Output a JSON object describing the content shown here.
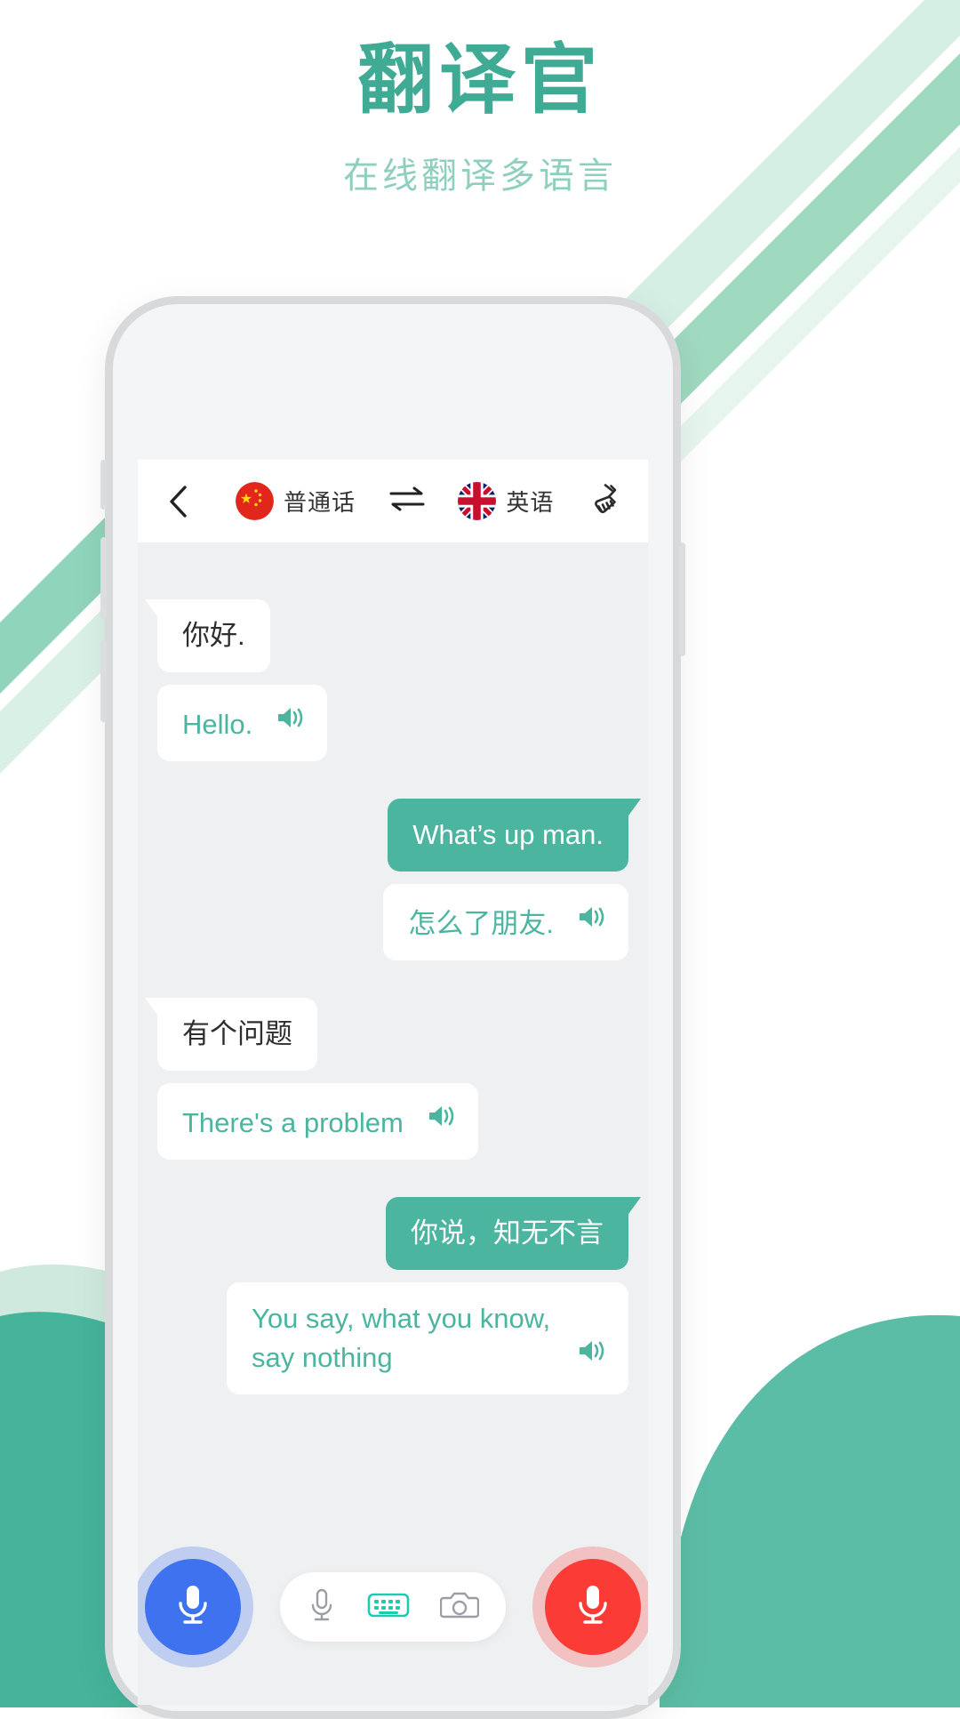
{
  "header": {
    "title": "翻译官",
    "subtitle": "在线翻译多语言"
  },
  "colors": {
    "brand_green": "#3fab95",
    "subtitle_green": "#8fcfbf",
    "bubble_green": "#4bb5a0",
    "mic_blue": "#3f72ee",
    "mic_red": "#fb3b36",
    "keyboard_teal": "#1ecbb0",
    "screen_bg": "#eff0f2"
  },
  "navbar": {
    "back_icon": "chevron-left-icon",
    "source": {
      "flag": "china-flag-icon",
      "label": "普通话"
    },
    "swap_icon": "swap-horizontal-icon",
    "target": {
      "flag": "uk-flag-icon",
      "label": "英语"
    },
    "clear_icon": "broom-icon"
  },
  "chat": {
    "messages": [
      {
        "side": "left",
        "source": "你好.",
        "translation": "Hello.",
        "speaker_icon": "speaker-icon"
      },
      {
        "side": "right",
        "source": "What’s up man.",
        "translation": "怎么了朋友.",
        "speaker_icon": "speaker-icon"
      },
      {
        "side": "left",
        "source": "有个问题",
        "translation": "There's a problem",
        "speaker_icon": "speaker-icon"
      },
      {
        "side": "right",
        "source": "你说，知无不言",
        "translation": "You say, what you know, say nothing",
        "speaker_icon": "speaker-icon"
      }
    ]
  },
  "bottombar": {
    "left_mic": "microphone-icon",
    "right_mic": "microphone-icon",
    "tools": [
      {
        "icon": "microphone-icon",
        "active": false
      },
      {
        "icon": "keyboard-icon",
        "active": true
      },
      {
        "icon": "camera-icon",
        "active": false
      }
    ]
  }
}
